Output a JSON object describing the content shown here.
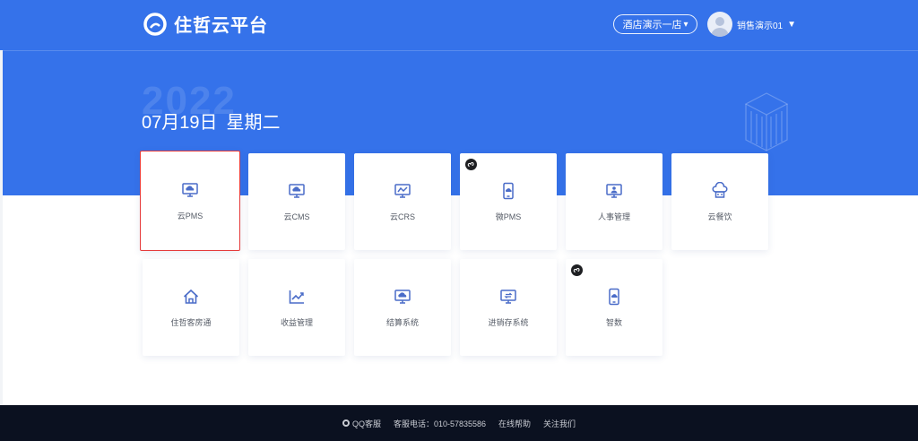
{
  "header": {
    "logo_text": "住哲云平台",
    "hotel_select": "酒店演示一店",
    "user_name": "销售演示01"
  },
  "hero": {
    "year": "2022",
    "date": "07月19日",
    "weekday": "星期二"
  },
  "apps": [
    {
      "label": "云PMS",
      "icon": "cloud-monitor-icon",
      "selected": true
    },
    {
      "label": "云CMS",
      "icon": "cloud-monitor-icon"
    },
    {
      "label": "云CRS",
      "icon": "chart-monitor-icon"
    },
    {
      "label": "微PMS",
      "icon": "mobile-cloud-icon",
      "badge": "mini-program-icon"
    },
    {
      "label": "人事管理",
      "icon": "person-monitor-icon"
    },
    {
      "label": "云餐饮",
      "icon": "chef-hat-icon"
    },
    {
      "label": "住哲客房通",
      "icon": "house-icon"
    },
    {
      "label": "收益管理",
      "icon": "trend-chart-icon"
    },
    {
      "label": "结算系统",
      "icon": "cloud-monitor-icon"
    },
    {
      "label": "进销存系统",
      "icon": "sync-monitor-icon"
    },
    {
      "label": "智数",
      "icon": "mobile-cloud-icon",
      "badge": "mini-program-icon"
    }
  ],
  "footer": {
    "qq": "QQ客服",
    "phone": "客服电话：010-57835586",
    "help": "在线帮助",
    "follow": "关注我们"
  },
  "colors": {
    "brand_blue": "#3572ea",
    "footer_bg": "#0b1120",
    "icon_blue": "#4a6cc8",
    "selected_border": "#e53a3a"
  }
}
